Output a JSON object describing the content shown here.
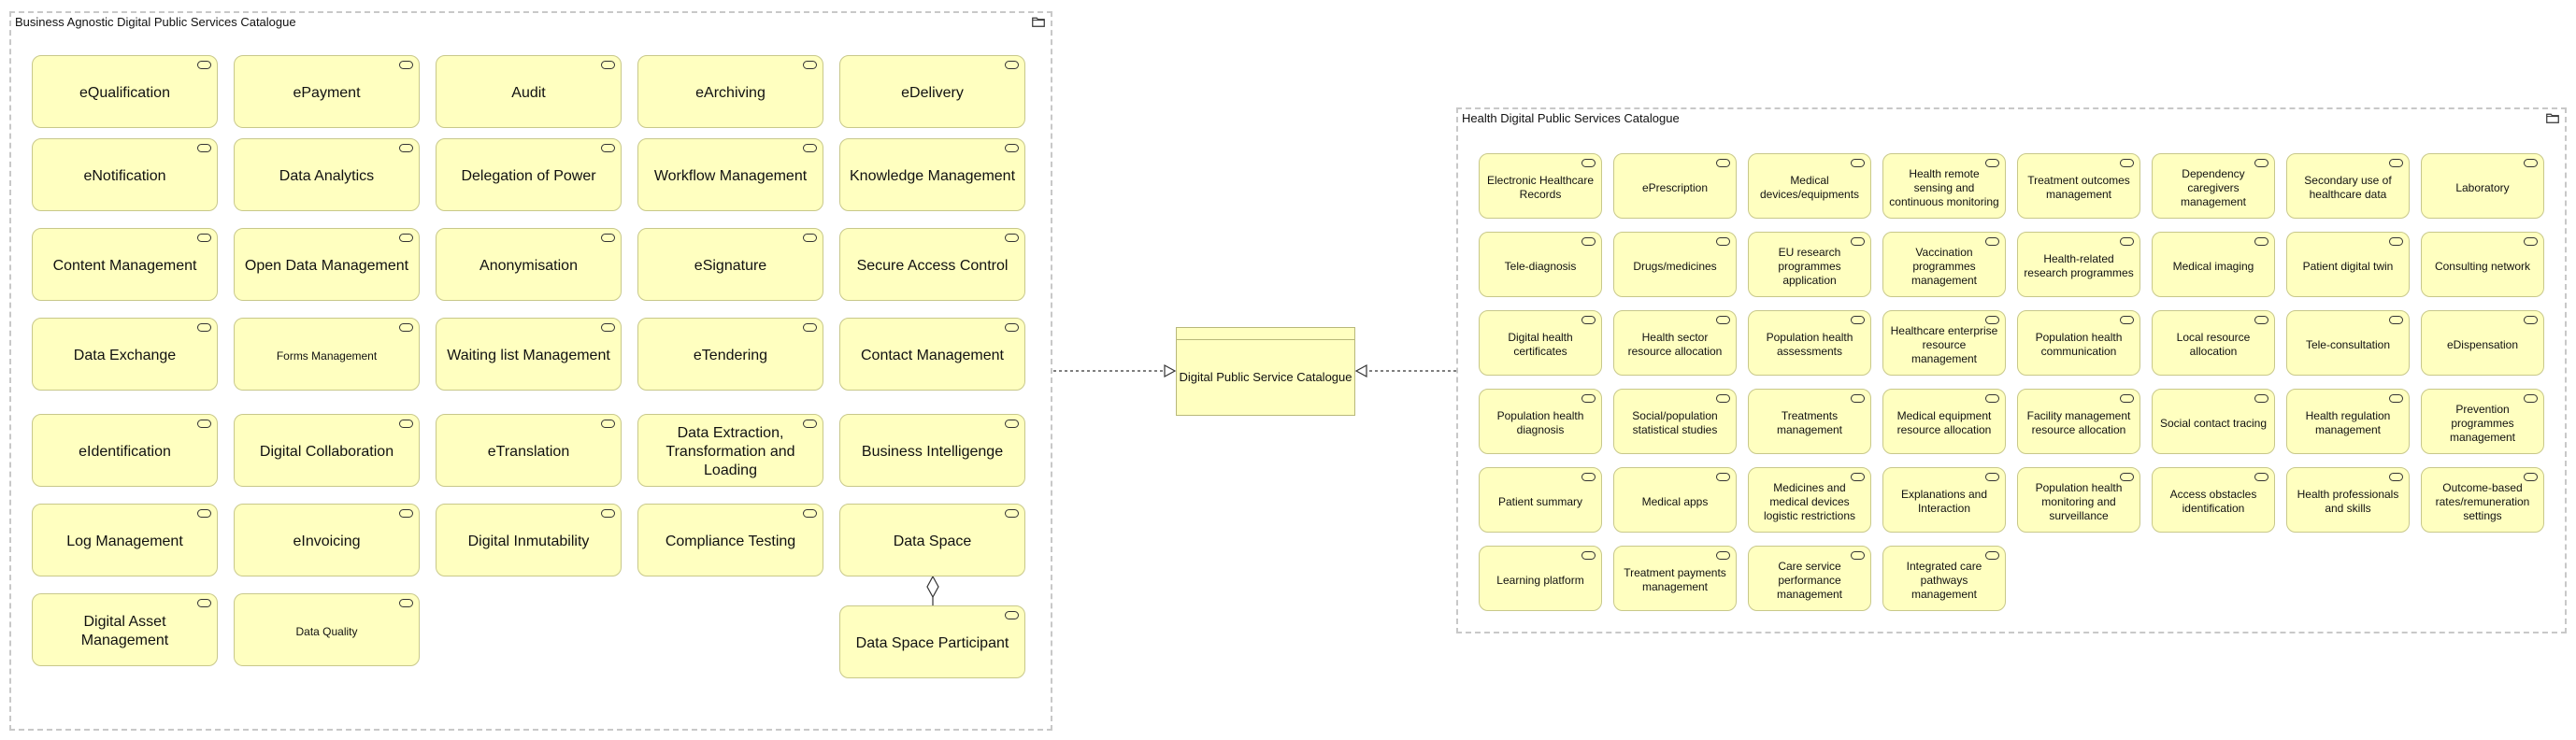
{
  "left_group": {
    "title": "Business Agnostic Digital Public Services Catalogue",
    "rows": [
      [
        "eQualification",
        "ePayment",
        "Audit",
        "eArchiving",
        "eDelivery"
      ],
      [
        "eNotification",
        "Data Analytics",
        "Delegation of Power",
        "Workflow Management",
        "Knowledge Management"
      ],
      [
        "Content Management",
        "Open Data Management",
        "Anonymisation",
        "eSignature",
        "Secure Access Control"
      ],
      [
        "Data Exchange",
        "Forms Management",
        "Waiting list Management",
        "eTendering",
        "Contact Management"
      ],
      [
        "eIdentification",
        "Digital Collaboration",
        "eTranslation",
        "Data Extraction, Transformation and Loading",
        "Business Intelligenge"
      ],
      [
        "Log Management",
        "eInvoicing",
        "Digital Inmutability",
        "Compliance Testing",
        "Data Space"
      ],
      [
        "Digital Asset Management",
        "Data Quality"
      ]
    ],
    "extra": "Data Space Participant"
  },
  "central": {
    "label": "Digital Public Service Catalogue"
  },
  "right_group": {
    "title": "Health Digital Public Services Catalogue",
    "rows": [
      [
        "Electronic Healthcare Records",
        "ePrescription",
        "Medical devices/equipments",
        "Health remote sensing and continuous monitoring",
        "Treatment outcomes management",
        "Dependency caregivers management",
        "Secondary use of healthcare data",
        "Laboratory"
      ],
      [
        "Tele-diagnosis",
        "Drugs/medicines",
        "EU research programmes application",
        "Vaccination programmes management",
        "Health-related research programmes",
        "Medical imaging",
        "Patient digital twin",
        "Consulting network"
      ],
      [
        "Digital health certificates",
        "Health sector resource allocation",
        "Population health assessments",
        "Healthcare enterprise resource management",
        "Population health communication",
        "Local resource allocation",
        "Tele-consultation",
        "eDispensation"
      ],
      [
        "Population health diagnosis",
        "Social/population statistical studies",
        "Treatments management",
        "Medical equipment resource allocation",
        "Facility management resource allocation",
        "Social contact tracing",
        "Health regulation management",
        "Prevention programmes management"
      ],
      [
        "Patient summary",
        "Medical apps",
        "Medicines and medical devices logistic restrictions",
        "Explanations and Interaction",
        "Population health monitoring and surveillance",
        "Access obstacles identification",
        "Health professionals and skills",
        "Outcome-based rates/remuneration settings"
      ],
      [
        "Learning platform",
        "Treatment payments management",
        "Care service performance management",
        "Integrated care pathways management"
      ]
    ]
  }
}
